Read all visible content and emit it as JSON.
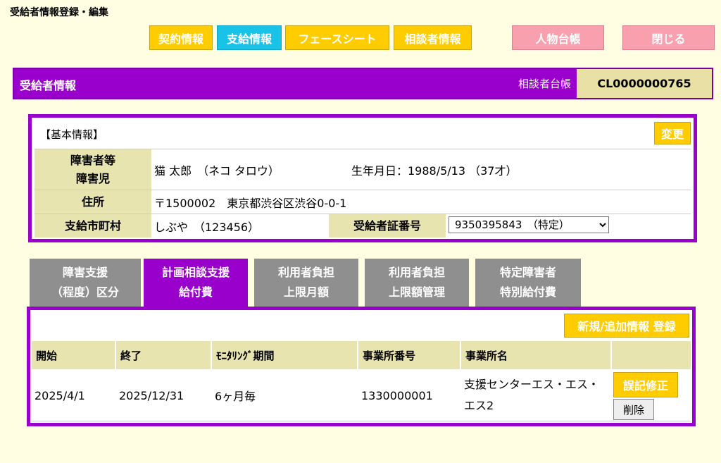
{
  "page_title": "受給者情報登録・編集",
  "nav": {
    "contract": "契約情報",
    "payment": "支給情報",
    "facesheet": "フェースシート",
    "consultant": "相談者情報",
    "person_ledger": "人物台帳",
    "close": "閉じる"
  },
  "header": {
    "title": "受給者情報",
    "ledger_label": "相談者台帳",
    "ledger_id": "CL0000000765"
  },
  "basic": {
    "section_label": "【基本情報】",
    "change_btn": "変更",
    "person_label_1": "障害者等",
    "person_label_2": "障害児",
    "name": "猫 太郎　（ネコ タロウ）",
    "birth": "生年月日：1988/5/13 （37才）",
    "address_label": "住所",
    "address": "〒1500002　東京都渋谷区渋谷0-0-1",
    "municipality_label": "支給市町村",
    "municipality": "しぶや　（123456）",
    "cert_label": "受給者証番号",
    "cert_selected": "9350395843　（特定）"
  },
  "tabs": [
    {
      "l1": "障害支援",
      "l2": "（程度）区分"
    },
    {
      "l1": "計画相談支援",
      "l2": "給付費"
    },
    {
      "l1": "利用者負担",
      "l2": "上限月額"
    },
    {
      "l1": "利用者負担",
      "l2": "上限額管理"
    },
    {
      "l1": "特定障害者",
      "l2": "特別給付費"
    }
  ],
  "plan": {
    "new_btn": "新規/追加情報 登録",
    "columns": [
      "開始",
      "終了",
      "ﾓﾆﾀﾘﾝｸﾞ期間",
      "事業所番号",
      "事業所名"
    ],
    "row": {
      "start": "2025/4/1",
      "end": "2025/12/31",
      "period": "6ヶ月毎",
      "office_no": "1330000001",
      "office_name": "支援センターエス・エス・エス2"
    },
    "fix_btn": "誤記修正",
    "delete_btn": "削除"
  },
  "colors": {
    "purple": "#9900cc",
    "yellow": "#ffcc00",
    "cyan": "#19c3e8",
    "pink": "#f9a0ae",
    "header_cell": "#e8e4b0",
    "background": "#fffde2"
  }
}
